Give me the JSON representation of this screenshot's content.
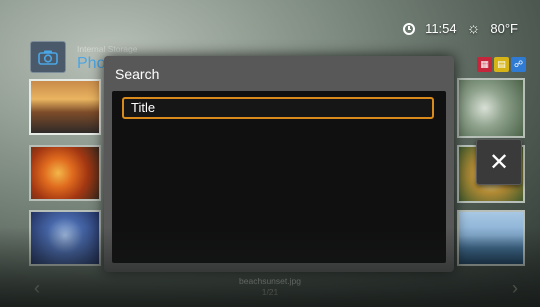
{
  "status": {
    "time": "11:54",
    "temperature": "80°F"
  },
  "header": {
    "storage_label": "Internal Storage",
    "section_title": "Photo"
  },
  "dialog": {
    "title": "Search",
    "items": [
      "Title"
    ]
  },
  "footer": {
    "file_name": "beachsunset.jpg",
    "page_count": "1/21"
  },
  "icons": {
    "clock": "clock-icon",
    "weather": "sun-icon",
    "camera": "camera-icon",
    "close": "close-icon",
    "prev": "chevron-left-icon",
    "next": "chevron-right-icon"
  },
  "colors": {
    "focus": "#d98a1c",
    "section": "#4aa6e6",
    "key_red": "#c6263b",
    "key_yellow": "#d6b417",
    "key_blue": "#2f7bd3"
  }
}
